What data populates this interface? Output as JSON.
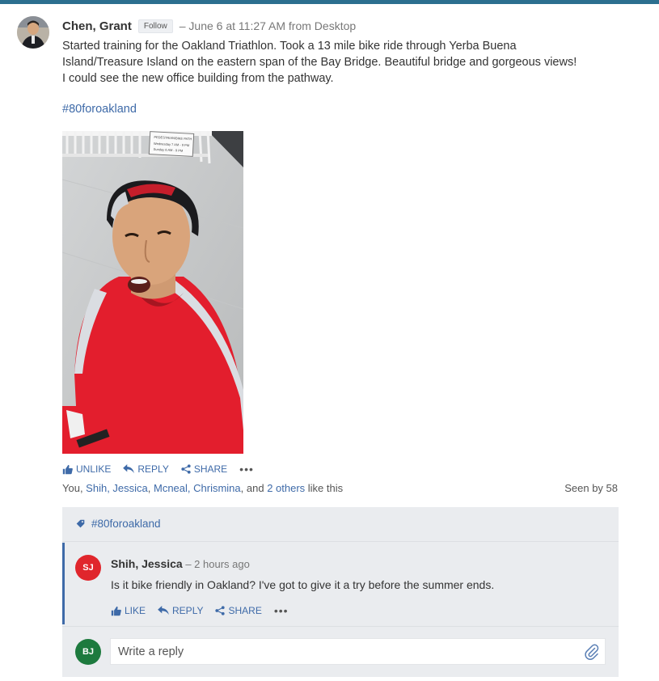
{
  "post": {
    "author": "Chen, Grant",
    "follow_label": "Follow",
    "meta": "– June 6 at 11:27 AM from Desktop",
    "body_lines": [
      "Started training for the Oakland Triathlon.  Took a 13 mile bike ride through Yerba Buena",
      "Island/Treasure Island on the eastern span of the Bay Bridge.  Beautiful bridge and gorgeous views!",
      "I could see the new office building from the pathway."
    ],
    "hashtag": "#80foroakland",
    "photo_icon": "selfie-photo",
    "sign_text": [
      "PEDESTRIAN/BIKE PATH",
      "Wednesday 7 AM - 9 PM",
      "Sunday 6 AM - 9 PM"
    ],
    "actions": {
      "unlike": "UNLIKE",
      "reply": "REPLY",
      "share": "SHARE",
      "more": "•••"
    },
    "likes": {
      "prefix": "You, ",
      "names": [
        "Shih, Jessica",
        "Mcneal, Chrismina"
      ],
      "others": "2 others",
      "suffix": " like this"
    },
    "seen": "Seen by 58"
  },
  "thread": {
    "topic": "#80foroakland",
    "comment": {
      "initials": "SJ",
      "author": "Shih, Jessica",
      "meta": " – 2 hours ago",
      "text": "Is it bike friendly in Oakland? I've got to give it a try before the summer ends.",
      "actions": {
        "like": "LIKE",
        "reply": "REPLY",
        "share": "SHARE",
        "more": "•••"
      },
      "avatar_color": "#e0262c"
    },
    "reply": {
      "initials": "BJ",
      "placeholder": "Write a reply",
      "avatar_color": "#1d7a3e"
    }
  },
  "colors": {
    "accent": "#3e6aa8",
    "topbar": "#2c6f8f",
    "thread_bg": "#eaecef"
  }
}
